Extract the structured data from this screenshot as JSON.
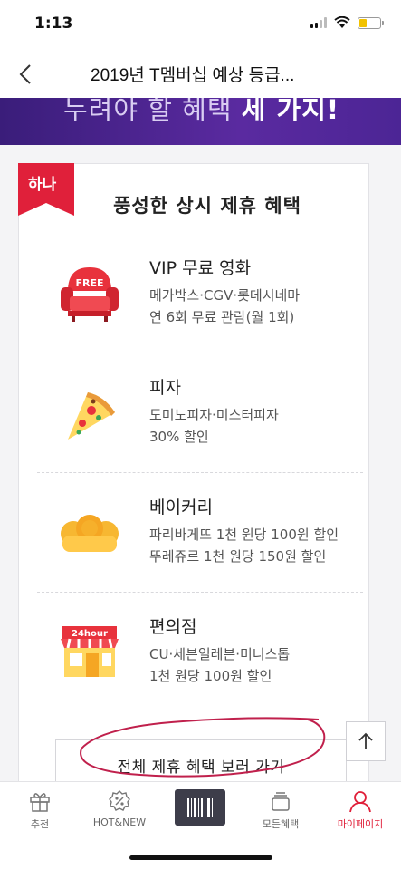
{
  "status_bar": {
    "time": "1:13",
    "battery_level": 0.38
  },
  "nav": {
    "title": "2019년 T멤버십 예상 등급..."
  },
  "banner": {
    "text_prefix": "누려야 할 혜택 ",
    "text_bold": "세 가지!"
  },
  "card": {
    "ribbon": "하나",
    "title": "풍성한 상시 제휴 혜택",
    "benefits": [
      {
        "title": "VIP 무료 영화",
        "line1": "메가박스·CGV·롯데시네마",
        "line2": "연 6회 무료 관람(월 1회)",
        "icon": "armchair-free-icon",
        "icon_text": "FREE"
      },
      {
        "title": "피자",
        "line1": "도미노피자·미스터피자",
        "line2": "30% 할인",
        "icon": "pizza-slice-icon"
      },
      {
        "title": "베이커리",
        "line1": "파리바게뜨 1천 원당 100원 할인",
        "line2": "뚜레쥬르 1천 원당 150원 할인",
        "icon": "bread-icon"
      },
      {
        "title": "편의점",
        "line1": "CU·세븐일레븐·미니스톱",
        "line2": "1천 원당 100원 할인",
        "icon": "convenience-store-icon",
        "icon_text": "24hour"
      }
    ],
    "all_button": "전체 제휴 혜택 보러 가기"
  },
  "tabs": [
    {
      "label": "추천",
      "icon": "gift-icon",
      "active": false
    },
    {
      "label": "HOT&NEW",
      "icon": "discount-badge-icon",
      "active": false
    },
    {
      "label": "모든혜택",
      "icon": "layers-icon",
      "active": false
    },
    {
      "label": "마이페이지",
      "icon": "person-icon",
      "active": true
    }
  ],
  "colors": {
    "accent": "#e0203a",
    "banner": "#4c2595",
    "barcode_button": "#3d3d4a"
  }
}
